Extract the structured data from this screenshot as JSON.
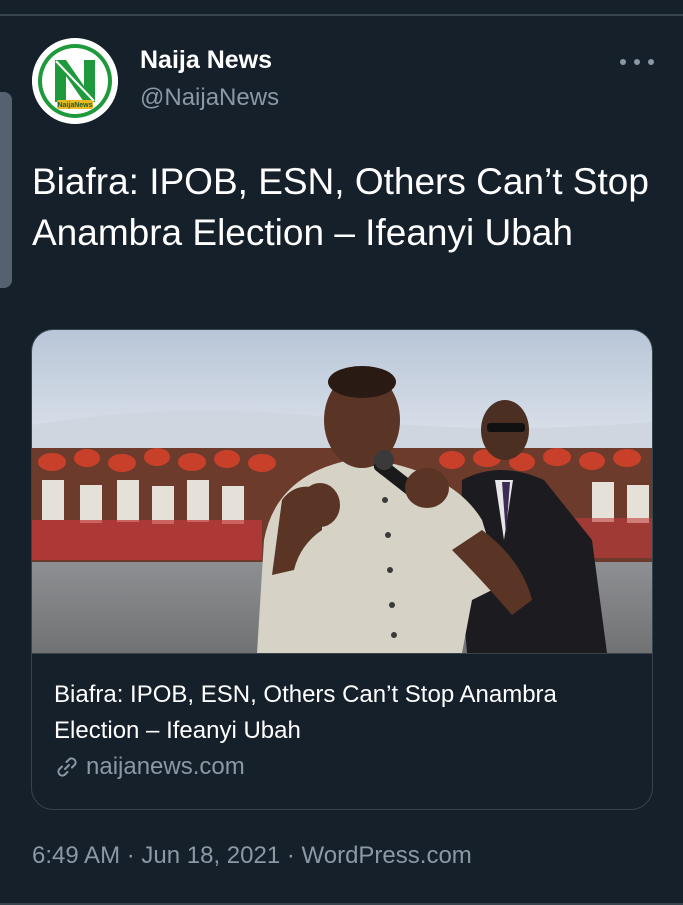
{
  "author": {
    "name": "Naija News",
    "handle": "@NaijaNews",
    "avatar_icon": "naija-news-logo",
    "avatar_logo_text": "NaijaNews"
  },
  "tweet": {
    "text": "Biafra: IPOB, ESN, Others Can’t Stop Anambra Election – Ifeanyi Ubah"
  },
  "card": {
    "title": "Biafra: IPOB, ESN, Others Can’t Stop Anambra Election – Ifeanyi Ubah",
    "domain": "naijanews.com",
    "domain_icon": "link-icon"
  },
  "meta": {
    "time": "6:49 AM",
    "separator": " · ",
    "date": "Jun 18, 2021",
    "source": "WordPress.com"
  },
  "colors": {
    "background": "#15202b",
    "secondary_text": "#8b98a5",
    "border": "#38444d",
    "brand_green": "#1e9a3c"
  }
}
